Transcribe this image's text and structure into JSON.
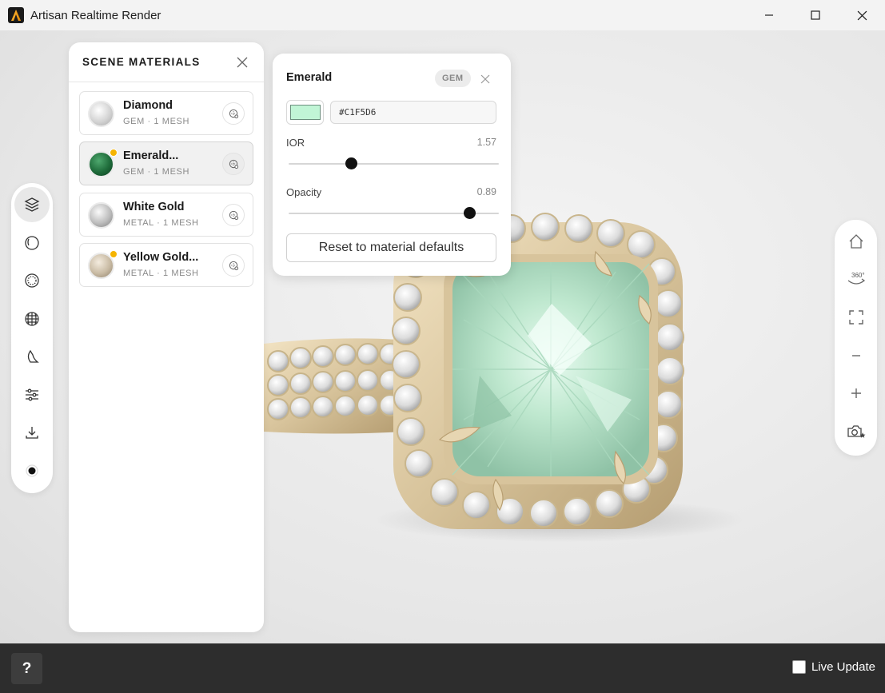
{
  "window": {
    "title": "Artisan Realtime Render",
    "controls": [
      "minimize-icon",
      "maximize-icon",
      "close-icon"
    ]
  },
  "left_toolbar": {
    "items": [
      {
        "name": "layers",
        "icon": "layers-icon",
        "active": true
      },
      {
        "name": "environment",
        "icon": "environment-sphere-icon",
        "active": false
      },
      {
        "name": "materials",
        "icon": "material-sphere-icon",
        "active": false
      },
      {
        "name": "globe",
        "icon": "globe-icon",
        "active": false
      },
      {
        "name": "lighting",
        "icon": "moon-light-icon",
        "active": false
      },
      {
        "name": "adjustments",
        "icon": "sliders-icon",
        "active": false
      },
      {
        "name": "export",
        "icon": "download-icon",
        "active": false
      },
      {
        "name": "render-mode",
        "icon": "record-dot-icon",
        "active": false
      }
    ]
  },
  "right_toolbar": {
    "items": [
      {
        "name": "home",
        "icon": "home-icon",
        "label": ""
      },
      {
        "name": "rotate-360",
        "icon": "rotate-360-icon",
        "label": "360°"
      },
      {
        "name": "fullscreen",
        "icon": "fullscreen-icon",
        "label": ""
      },
      {
        "name": "zoom-out",
        "icon": "minus-icon",
        "label": ""
      },
      {
        "name": "zoom-in",
        "icon": "plus-icon",
        "label": ""
      },
      {
        "name": "snapshot",
        "icon": "camera-star-icon",
        "label": ""
      }
    ]
  },
  "materials_panel": {
    "title": "SCENE MATERIALS",
    "items": [
      {
        "name": "Diamond",
        "subtitle": "GEM · 1 MESH",
        "modified": false,
        "selected": false,
        "swatch": "#d9d9d9"
      },
      {
        "name": "Emerald...",
        "subtitle": "GEM · 1 MESH",
        "modified": true,
        "selected": true,
        "swatch": "#1e6b3a"
      },
      {
        "name": "White Gold",
        "subtitle": "METAL · 1 MESH",
        "modified": false,
        "selected": false,
        "swatch": "#c6c6c6"
      },
      {
        "name": "Yellow Gold...",
        "subtitle": "METAL · 1 MESH",
        "modified": true,
        "selected": false,
        "swatch": "#c9bba4"
      }
    ]
  },
  "material_editor": {
    "title": "Emerald",
    "badge": "GEM",
    "color_hex": "#C1F5D6",
    "sliders": [
      {
        "label": "IOR",
        "value": "1.57",
        "position": 0.3
      },
      {
        "label": "Opacity",
        "value": "0.89",
        "position": 0.86
      }
    ],
    "reset_label": "Reset to material defaults"
  },
  "bottom_bar": {
    "help_label": "?",
    "live_update_label": "Live Update",
    "live_update_checked": false
  },
  "colors": {
    "accent_modified": "#f5b400",
    "bottom_bar": "#2d2d2d",
    "gem_tint": "#bfe8cf",
    "metal_gold": "#d8c49c"
  }
}
